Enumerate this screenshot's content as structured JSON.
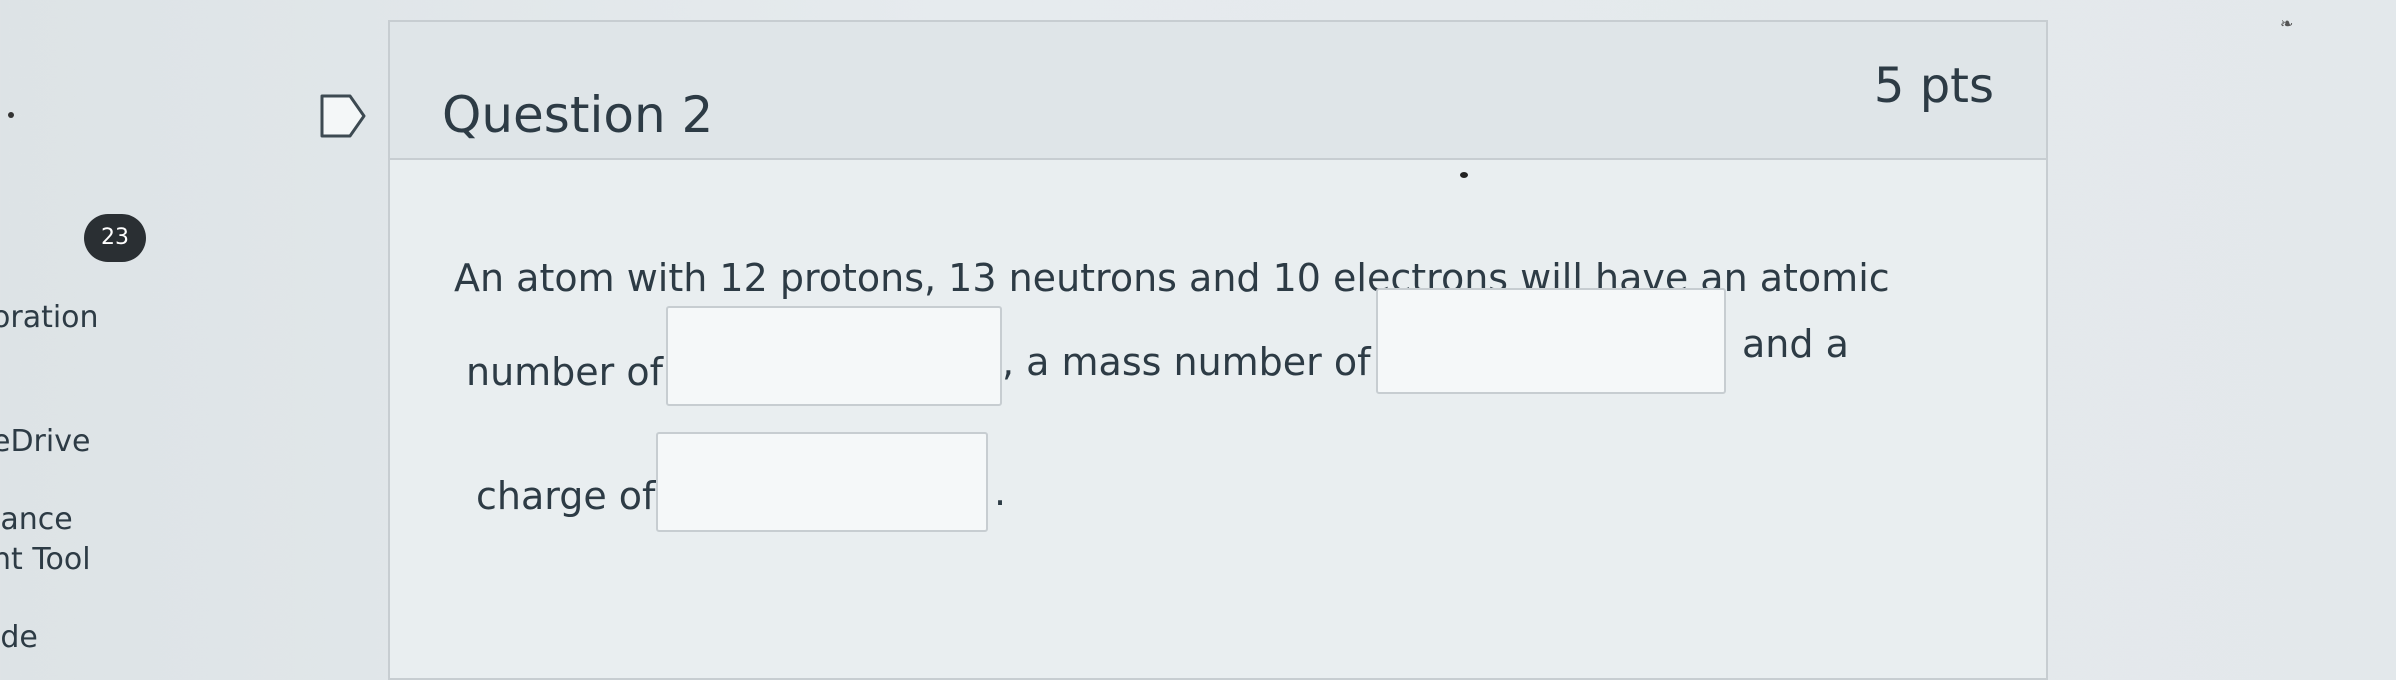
{
  "nav": {
    "badge": "23",
    "items": [
      {
        "label": "oration"
      },
      {
        "label": "eDrive"
      },
      {
        "label": "lance"
      },
      {
        "label": "nt Tool"
      },
      {
        "label": "ide"
      }
    ]
  },
  "question": {
    "title": "Question 2",
    "points": "5 pts",
    "text_part1": "An atom with 12 protons, 13 neutrons and 10 electrons will have an atomic",
    "text_part2": "number of",
    "text_part3": ", a mass number of",
    "text_part4": "and a",
    "text_part5": "charge of",
    "text_part6": ".",
    "answers": {
      "atomic_number": "",
      "mass_number": "",
      "charge": ""
    }
  }
}
